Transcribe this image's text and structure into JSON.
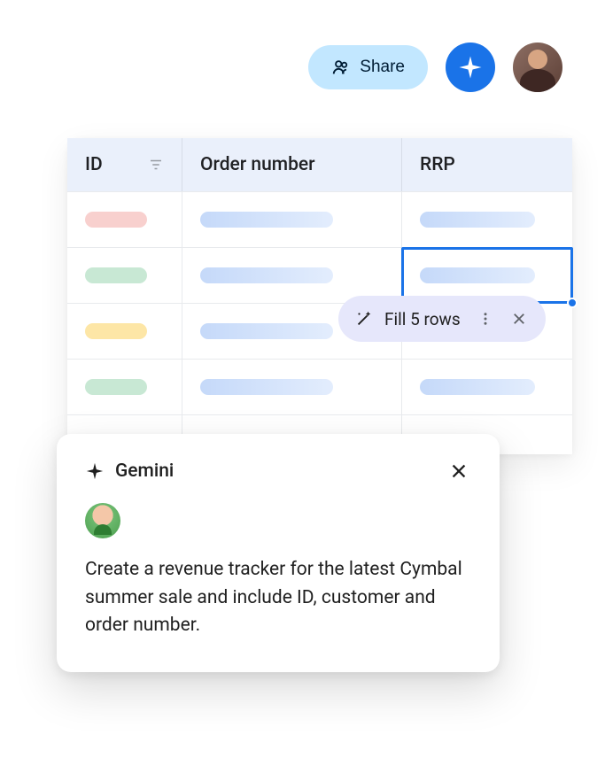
{
  "topbar": {
    "share_label": "Share"
  },
  "table": {
    "columns": {
      "id": "ID",
      "order_number": "Order number",
      "rrp": "RRP"
    },
    "rows": [
      {
        "id_color": "ph-red"
      },
      {
        "id_color": "ph-green",
        "selected_rrp": true
      },
      {
        "id_color": "ph-yellow"
      },
      {
        "id_color": "ph-green"
      }
    ]
  },
  "fill_popup": {
    "label": "Fill 5 rows"
  },
  "gemini": {
    "title": "Gemini",
    "prompt": "Create a revenue tracker for the latest Cymbal summer sale and include ID, customer and order number."
  }
}
